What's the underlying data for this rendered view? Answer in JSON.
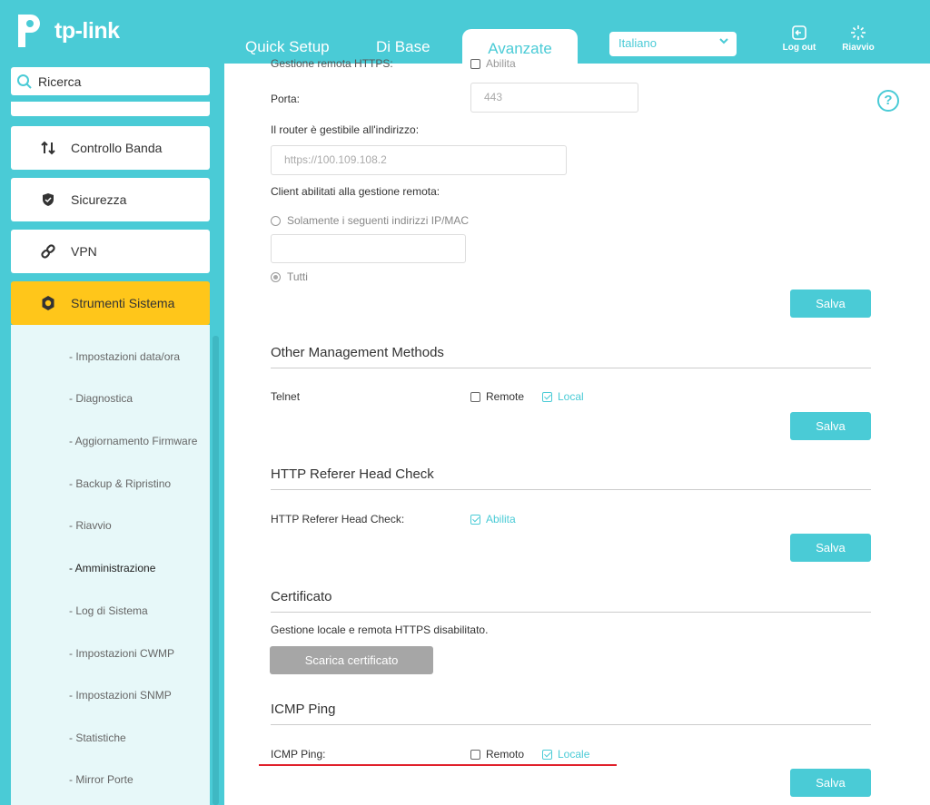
{
  "header": {
    "brand": "tp-link",
    "tabs": [
      "Quick Setup",
      "Di Base",
      "Avanzate"
    ],
    "language": "Italiano",
    "logout_label": "Log out",
    "reboot_label": "Riavvio"
  },
  "sidebar": {
    "search_placeholder": "Ricerca",
    "items": [
      {
        "label": "Controllo Banda",
        "icon": "up-down-arrows-icon"
      },
      {
        "label": "Sicurezza",
        "icon": "shield-icon"
      },
      {
        "label": "VPN",
        "icon": "link-icon"
      },
      {
        "label": "Strumenti Sistema",
        "icon": "gear-icon"
      }
    ],
    "subitems": [
      "- Impostazioni data/ora",
      "- Diagnostica",
      "- Aggiornamento Firmware",
      "- Backup & Ripristino",
      "- Riavvio",
      "- Amministrazione",
      "- Log di Sistema",
      "- Impostazioni CWMP",
      "- Impostazioni SNMP",
      "- Statistiche",
      "- Mirror Porte"
    ]
  },
  "remote": {
    "cut_label": "Gestione remota HTTPS:",
    "cut_enable": "Abilita",
    "port_label": "Porta:",
    "port_value": "443",
    "address_label": "Il router è gestibile all'indirizzo:",
    "address_value": "https://100.109.108.2",
    "clients_label": "Client abilitati alla gestione remota:",
    "option_specific": "Solamente i seguenti indirizzi IP/MAC",
    "option_all": "Tutti",
    "save": "Salva"
  },
  "other": {
    "title": "Other Management Methods",
    "telnet_label": "Telnet",
    "remote": "Remote",
    "local": "Local",
    "save": "Salva"
  },
  "referer": {
    "title": "HTTP Referer Head Check",
    "label": "HTTP Referer Head Check:",
    "enable": "Abilita",
    "save": "Salva"
  },
  "cert": {
    "title": "Certificato",
    "status": "Gestione locale e remota HTTPS disabilitato.",
    "download": "Scarica certificato"
  },
  "icmp": {
    "title": "ICMP Ping",
    "label": "ICMP Ping:",
    "remote": "Remoto",
    "local": "Locale",
    "save": "Salva"
  },
  "colors": {
    "brand": "#4acbd6",
    "active": "#ffc61a",
    "highlight": "#e0202a"
  }
}
